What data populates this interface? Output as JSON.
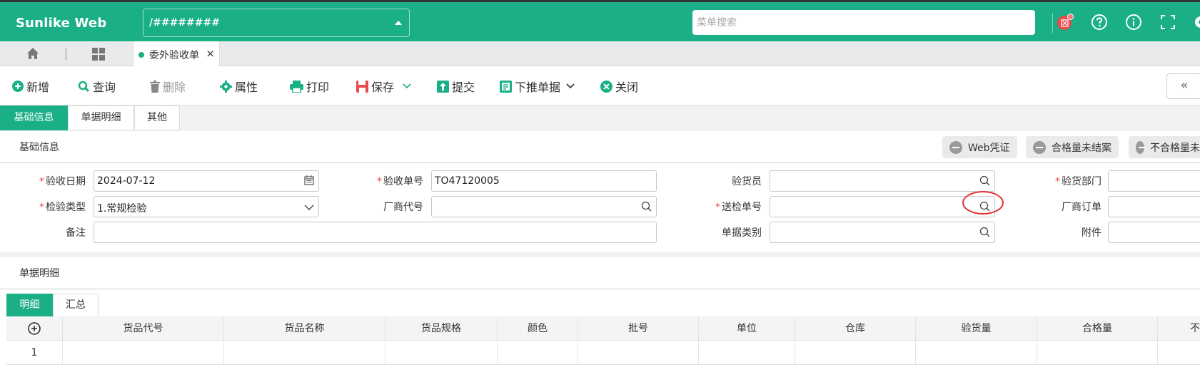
{
  "app": {
    "brand": "Sunlike Web"
  },
  "header": {
    "project_value": "/########",
    "menu_search_placeholder": "菜单搜索",
    "icons": [
      "notification-icon",
      "help-icon",
      "info-icon",
      "fullscreen-icon",
      "gear-icon"
    ],
    "accent_color": "#1aaf86"
  },
  "tabs": {
    "open_tab": "委外验收单"
  },
  "toolbar": {
    "add": "新增",
    "query": "查询",
    "delete": "删除",
    "properties": "属性",
    "print": "打印",
    "save": "保存",
    "submit": "提交",
    "push_down": "下推单据",
    "close": "关闭",
    "collapse": "«"
  },
  "section_tabs": [
    "基础信息",
    "单据明细",
    "其他"
  ],
  "basic": {
    "title": "基础信息",
    "chips": [
      "Web凭证",
      "合格量未结案",
      "不合格量未"
    ]
  },
  "form": {
    "inspect_date_label": "验收日期",
    "inspect_date": "2024-07-12",
    "inspect_no_label": "验收单号",
    "inspect_no": "TO47120005",
    "inspector_label": "验货员",
    "inspector": "",
    "dept_label": "验货部门",
    "dept": "",
    "inspect_type_label": "检验类型",
    "inspect_type": "1.常规检验",
    "vendor_code_label": "厂商代号",
    "vendor_code": "",
    "send_no_label": "送检单号",
    "send_no": "",
    "vendor_order_label": "厂商订单",
    "vendor_order": "",
    "remark_label": "备注",
    "remark": "",
    "doc_type_label": "单据类别",
    "doc_type": "",
    "attach_label": "附件",
    "attach": ""
  },
  "detail": {
    "title": "单据明细",
    "tabs": [
      "明细",
      "汇总"
    ],
    "columns": [
      "货品代号",
      "货品名称",
      "货品规格",
      "颜色",
      "批号",
      "单位",
      "仓库",
      "验货量",
      "合格量",
      "不"
    ],
    "rows": [
      [
        "1",
        "",
        "",
        "",
        "",
        "",
        "",
        "",
        "",
        "",
        ""
      ]
    ]
  }
}
